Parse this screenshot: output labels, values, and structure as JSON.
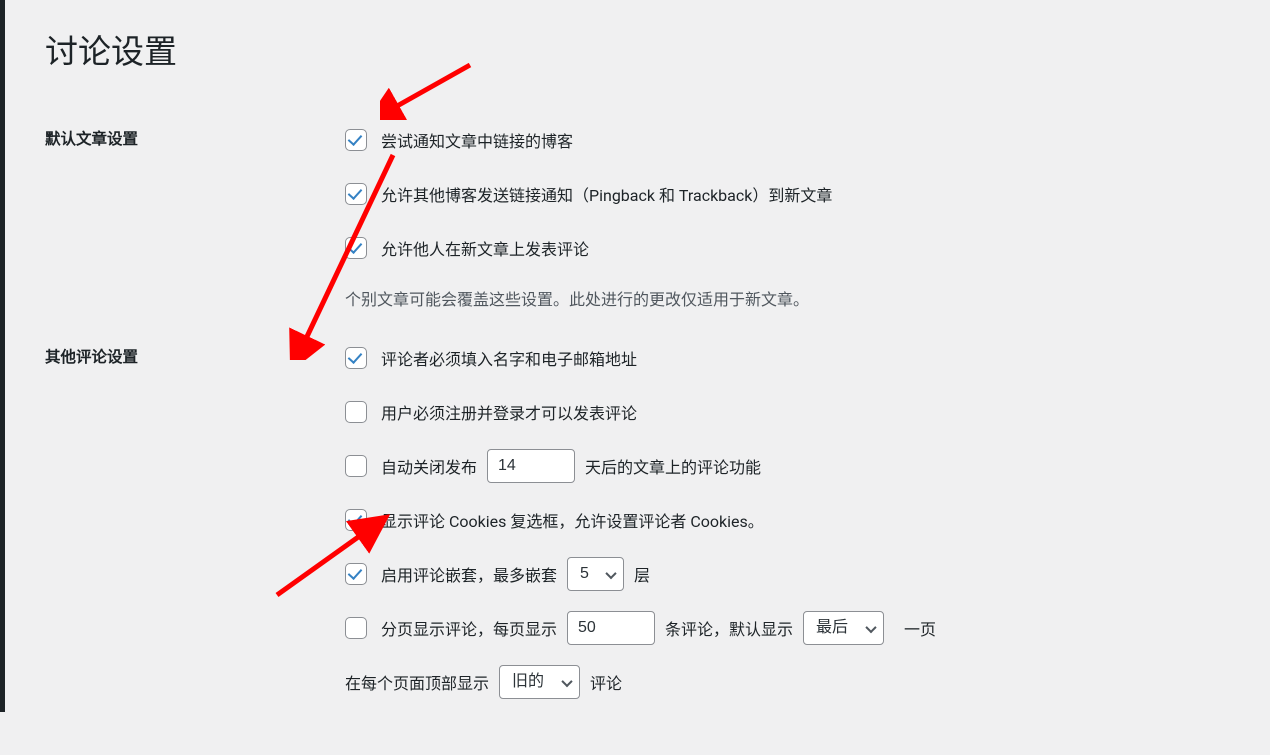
{
  "page_title": "讨论设置",
  "sections": {
    "default_article": {
      "heading": "默认文章设置",
      "options": {
        "attempt_notify": {
          "label": "尝试通知文章中链接的博客",
          "checked": true
        },
        "allow_pingback": {
          "label": "允许其他博客发送链接通知（Pingback 和 Trackback）到新文章",
          "checked": true
        },
        "allow_comments": {
          "label": "允许他人在新文章上发表评论",
          "checked": true
        }
      },
      "note": "个别文章可能会覆盖这些设置。此处进行的更改仅适用于新文章。"
    },
    "other_comments": {
      "heading": "其他评论设置",
      "options": {
        "require_name_email": {
          "label": "评论者必须填入名字和电子邮箱地址",
          "checked": true
        },
        "require_login": {
          "label": "用户必须注册并登录才可以发表评论",
          "checked": false
        },
        "close_after": {
          "checked": false,
          "prefix": "自动关闭发布",
          "value": "14",
          "suffix": "天后的文章上的评论功能"
        },
        "show_cookies": {
          "label": "显示评论 Cookies 复选框，允许设置评论者 Cookies。",
          "checked": true
        },
        "thread_comments": {
          "checked": true,
          "prefix": "启用评论嵌套，最多嵌套",
          "value": "5",
          "suffix": "层"
        },
        "page_comments": {
          "checked": false,
          "prefix": "分页显示评论，每页显示",
          "per_page_value": "50",
          "middle": "条评论，默认显示",
          "default_page_value": "最后",
          "suffix": "一页"
        },
        "comment_order": {
          "prefix": "在每个页面顶部显示",
          "value": "旧的",
          "suffix": "评论"
        }
      }
    }
  },
  "colors": {
    "accent": "#3582c4",
    "arrow": "#ff0000"
  }
}
